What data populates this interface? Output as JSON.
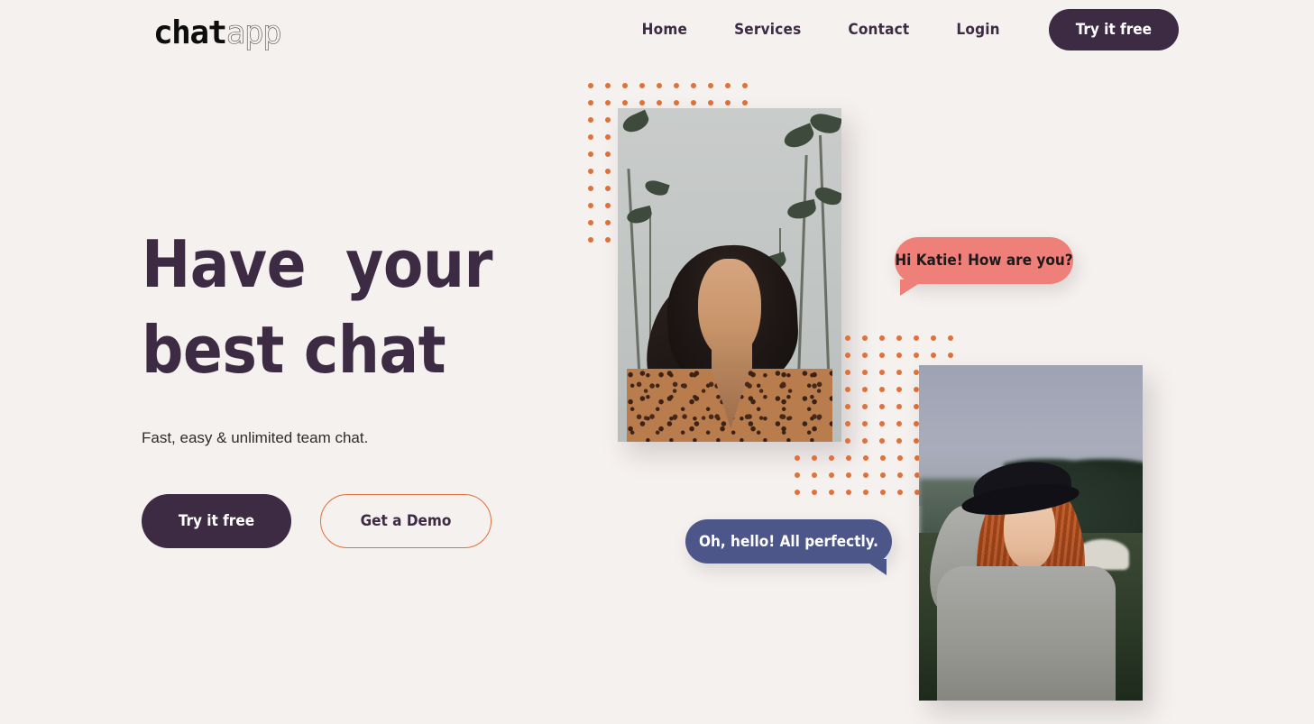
{
  "colors": {
    "background": "#f5f1ef",
    "brand_dark": "#3d2b44",
    "accent_orange": "#e2703a",
    "bubble_coral": "#ef8079",
    "bubble_blue": "#4c5689",
    "text_body": "#2d2d2d"
  },
  "header": {
    "logo_primary": "chat",
    "logo_secondary": "app",
    "nav": [
      {
        "label": "Home"
      },
      {
        "label": "Services"
      },
      {
        "label": "Contact"
      },
      {
        "label": "Login"
      }
    ],
    "cta_label": "Try it free"
  },
  "hero": {
    "headline_line1": "Have  your",
    "headline_line2": "best chat",
    "subhead": "Fast, easy & unlimited team chat.",
    "primary_button": "Try it free",
    "secondary_button": "Get a Demo"
  },
  "chat_bubbles": [
    {
      "text": "Hi Katie! How are you?",
      "style": "coral",
      "tail": "bottom-left"
    },
    {
      "text": "Oh, hello! All perfectly.",
      "style": "blue",
      "tail": "bottom-right"
    }
  ],
  "photos": [
    {
      "alt": "smiling woman with dark hair in leopard print blouse against palm trees"
    },
    {
      "alt": "smiling red haired woman wearing a black hat and grey sweater in a field"
    }
  ],
  "decorations": {
    "dot_grid_1": {
      "dot_color": "#e2703a",
      "spacing": 19,
      "dot_size": 6
    },
    "dot_grid_2": {
      "dot_color": "#e2703a",
      "spacing": 19,
      "dot_size": 6
    }
  }
}
